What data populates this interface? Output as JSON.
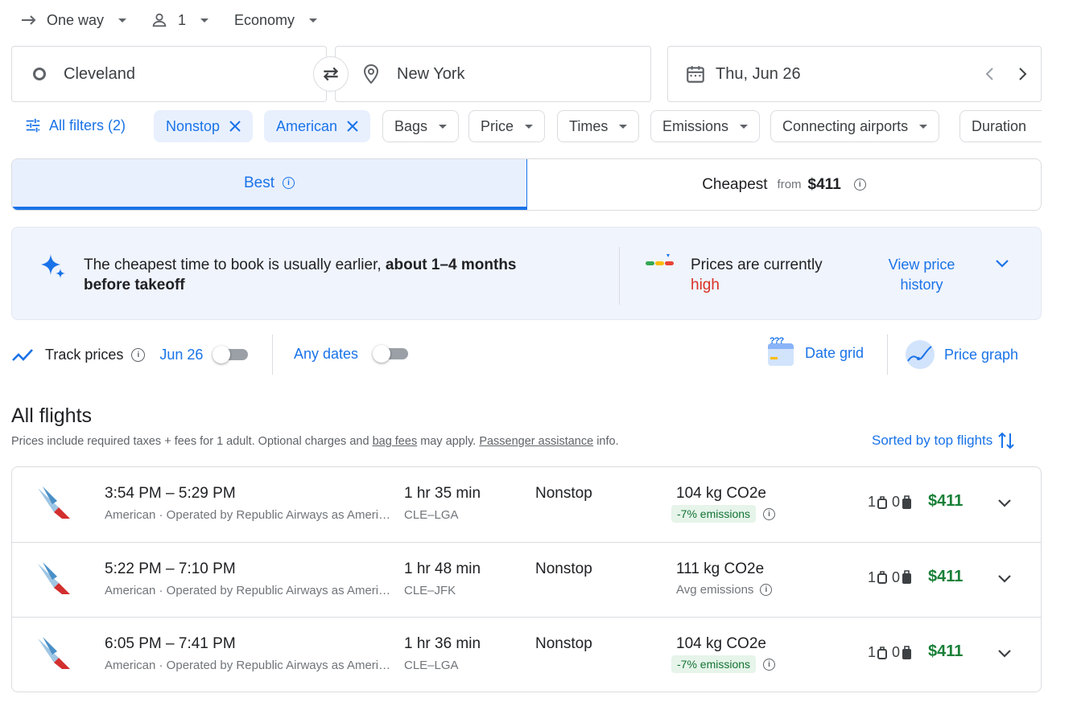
{
  "search": {
    "trip_type": "One way",
    "passengers": "1",
    "cabin": "Economy",
    "origin": "Cleveland",
    "destination": "New York",
    "date": "Thu, Jun 26"
  },
  "filters": {
    "all_filters": "All filters (2)",
    "chips": [
      "Nonstop",
      "American",
      "Bags",
      "Price",
      "Times",
      "Emissions",
      "Connecting airports",
      "Duration"
    ]
  },
  "tabs": {
    "best": "Best",
    "cheapest": "Cheapest",
    "cheapest_from": "from",
    "cheapest_price": "$411"
  },
  "insight": {
    "text_pre": "The cheapest time to book is usually earlier, ",
    "text_bold_1": "about 1–4 months",
    "text_bold_2": "before takeoff",
    "prices_label": "Prices are currently",
    "prices_level": "high",
    "history_link_1": "View price",
    "history_link_2": "history"
  },
  "tracking": {
    "track_label": "Track prices",
    "track_date": "Jun 26",
    "any_dates": "Any dates",
    "date_grid": "Date grid",
    "price_graph": "Price graph",
    "date_grid_icon_text": "???"
  },
  "results": {
    "heading": "All flights",
    "note_pre": "Prices include required taxes + fees for 1 adult. Optional charges and ",
    "bag_fees": "bag fees",
    "note_mid": " may apply. ",
    "passenger_assistance": "Passenger assistance",
    "note_post": " info.",
    "sort_label": "Sorted by top flights"
  },
  "flights": [
    {
      "times": "3:54 PM – 5:29 PM",
      "airline": "American · Operated by Republic Airways as American Eagle",
      "duration": "1 hr 35 min",
      "route": "CLE–LGA",
      "stops": "Nonstop",
      "co2": "104 kg CO2e",
      "emissions": "-7% emissions",
      "emissions_type": "lower",
      "carry_on": "1",
      "checked": "0",
      "price": "$411"
    },
    {
      "times": "5:22 PM – 7:10 PM",
      "airline": "American · Operated by Republic Airways as American Eagle",
      "duration": "1 hr 48 min",
      "route": "CLE–JFK",
      "stops": "Nonstop",
      "co2": "111 kg CO2e",
      "emissions": "Avg emissions",
      "emissions_type": "avg",
      "carry_on": "1",
      "checked": "0",
      "price": "$411"
    },
    {
      "times": "6:05 PM – 7:41 PM",
      "airline": "American · Operated by Republic Airways as American Eagle",
      "duration": "1 hr 36 min",
      "route": "CLE–LGA",
      "stops": "Nonstop",
      "co2": "104 kg CO2e",
      "emissions": "-7% emissions",
      "emissions_type": "lower",
      "carry_on": "1",
      "checked": "0",
      "price": "$411"
    }
  ],
  "colors": {
    "accent": "#1a73e8",
    "price_green": "#188038",
    "price_high_red": "#d93025",
    "emissions_badge_bg": "#e6f4ea"
  }
}
